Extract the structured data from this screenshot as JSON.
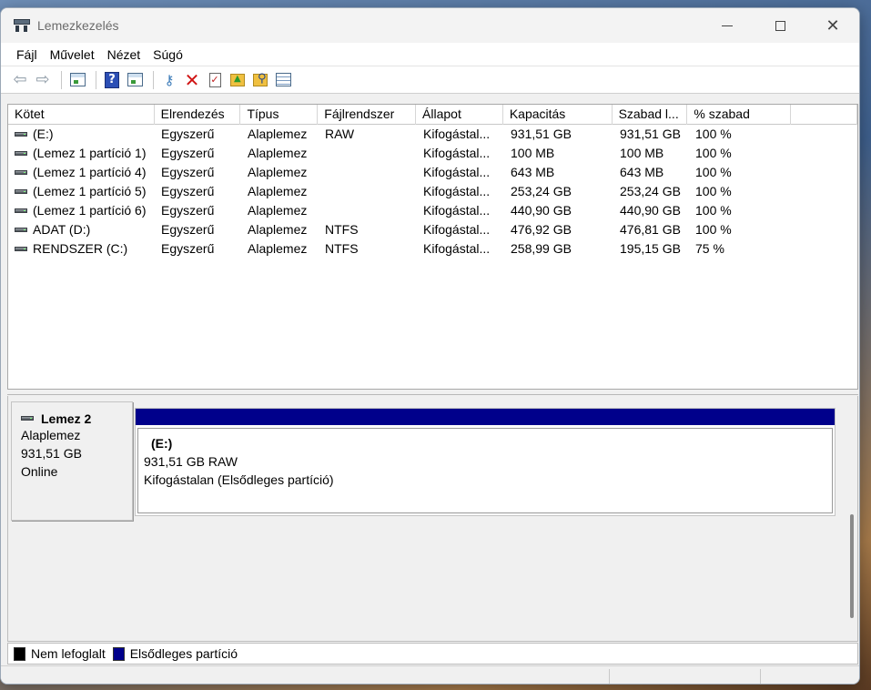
{
  "window": {
    "title": "Lemezkezelés"
  },
  "menu": [
    "Fájl",
    "Művelet",
    "Nézet",
    "Súgó"
  ],
  "toolbar": {
    "icons": [
      "back-arrow-icon",
      "forward-arrow-icon",
      "console-tree-icon",
      "help-icon",
      "show-hide-pane-icon",
      "connect-drive-icon",
      "delete-icon",
      "properties-icon",
      "folder-up-icon",
      "folder-search-icon",
      "list-view-icon"
    ]
  },
  "volume_list": {
    "columns": [
      "Kötet",
      "Elrendezés",
      "Típus",
      "Fájlrendszer",
      "Állapot",
      "Kapacitás",
      "Szabad l...",
      "% szabad"
    ],
    "rows": [
      [
        "(E:)",
        "Egyszerű",
        "Alaplemez",
        "RAW",
        "Kifogástal...",
        "931,51 GB",
        "931,51 GB",
        "100 %"
      ],
      [
        "(Lemez 1 partíció 1)",
        "Egyszerű",
        "Alaplemez",
        "",
        "Kifogástal...",
        "100 MB",
        "100 MB",
        "100 %"
      ],
      [
        "(Lemez 1 partíció 4)",
        "Egyszerű",
        "Alaplemez",
        "",
        "Kifogástal...",
        "643 MB",
        "643 MB",
        "100 %"
      ],
      [
        "(Lemez 1 partíció 5)",
        "Egyszerű",
        "Alaplemez",
        "",
        "Kifogástal...",
        "253,24 GB",
        "253,24 GB",
        "100 %"
      ],
      [
        "(Lemez 1 partíció 6)",
        "Egyszerű",
        "Alaplemez",
        "",
        "Kifogástal...",
        "440,90 GB",
        "440,90 GB",
        "100 %"
      ],
      [
        "ADAT (D:)",
        "Egyszerű",
        "Alaplemez",
        "NTFS",
        "Kifogástal...",
        "476,92 GB",
        "476,81 GB",
        "100 %"
      ],
      [
        "RENDSZER (C:)",
        "Egyszerű",
        "Alaplemez",
        "NTFS",
        "Kifogástal...",
        "258,99 GB",
        "195,15 GB",
        "75 %"
      ]
    ]
  },
  "disk": {
    "name": "Lemez 2",
    "type": "Alaplemez",
    "size": "931,51 GB",
    "status": "Online",
    "partition": {
      "label": "(E:)",
      "size_fs": "931,51 GB RAW",
      "status": "Kifogástalan (Elsődleges partíció)",
      "color": "#00008b"
    }
  },
  "legend": [
    {
      "label": "Nem lefoglalt",
      "color": "#000000"
    },
    {
      "label": "Elsődleges partíció",
      "color": "#00008b"
    }
  ]
}
